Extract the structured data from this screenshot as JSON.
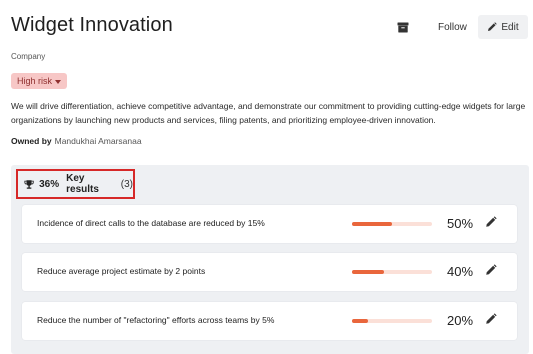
{
  "header": {
    "title": "Widget Innovation",
    "archive_icon": "archive-icon",
    "follow_label": "Follow",
    "edit_label": "Edit",
    "edit_icon": "pencil-icon"
  },
  "item_type": "Company",
  "risk": {
    "label": "High risk",
    "color": "#f7c7c6",
    "text_color": "#8f2f2e"
  },
  "description": "We will drive differentiation, achieve competitive advantage, and demonstrate our commitment to providing cutting-edge widgets for large organizations by launching new products and services, filing patents, and prioritizing employee-driven innovation.",
  "owner": {
    "prefix": "Owned by",
    "name": "Mandukhai Amarsanaa"
  },
  "key_results": {
    "icon": "trophy-icon",
    "progress": "36%",
    "title": "Key results",
    "count": "(3)",
    "accent_color": "#e9663c",
    "items": [
      {
        "text": "Incidence of direct calls to the database are reduced by 15%",
        "progress_label": "50%",
        "progress": 0.5
      },
      {
        "text": "Reduce average project estimate by 2 points",
        "progress_label": "40%",
        "progress": 0.4
      },
      {
        "text": "Reduce the number of \"refactoring\" efforts across teams by 5%",
        "progress_label": "20%",
        "progress": 0.2
      }
    ]
  }
}
